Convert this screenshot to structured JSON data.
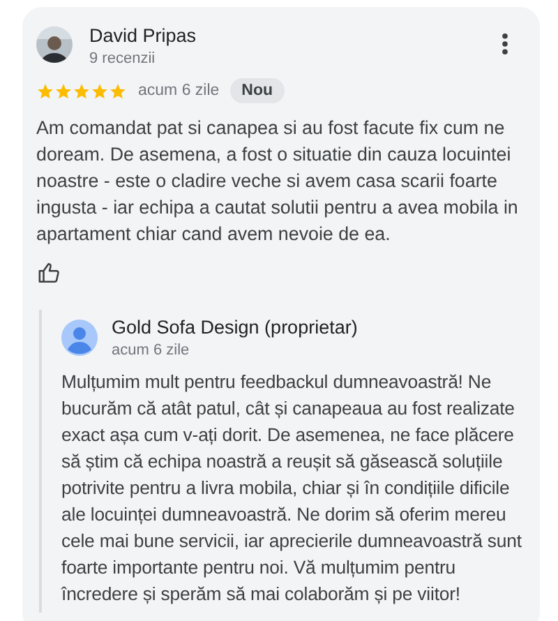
{
  "review": {
    "author": "David Pripas",
    "author_meta": "9 recenzii",
    "stars": 5,
    "time": "acum 6 zile",
    "badge": "Nou",
    "text": "Am comandat pat si canapea si au fost facute fix cum ne doream. De asemena, a fost o situatie din cauza locuintei noastre - este o cladire veche si avem casa scarii foarte ingusta - iar echipa a cautat solutii pentru a avea mobila in apartament chiar cand avem nevoie de ea."
  },
  "reply": {
    "author": "Gold Sofa Design (proprietar)",
    "time": "acum 6 zile",
    "text": "Mulțumim mult pentru feedbackul dumneavoastră! Ne bucurăm că atât patul, cât și canapeaua au fost realizate exact așa cum v-ați dorit. De asemenea, ne face plăcere să știm că echipa noastră a reușit să găsească soluțiile potrivite pentru a livra mobila, chiar și în condițiile dificile ale locuinței dumneavoastră. Ne dorim să oferim mereu cele mai bune servicii, iar aprecierile dumneavoastră sunt foarte importante pentru noi. Vă mulțumim pentru încredere și sperăm să mai colaborăm și pe viitor!"
  }
}
